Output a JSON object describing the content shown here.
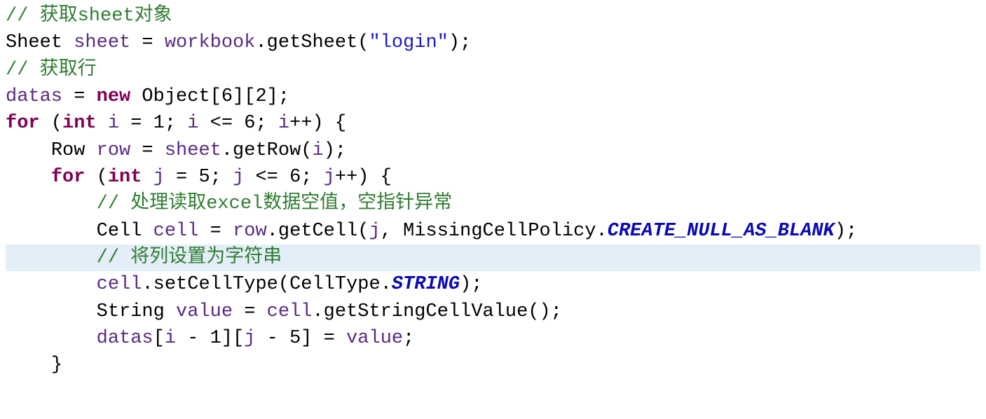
{
  "code": {
    "l0_comment": "// 获取sheet对象",
    "l1_a": "Sheet ",
    "l1_b": "sheet",
    "l1_c": " = ",
    "l1_d": "workbook",
    "l1_e": ".getSheet(",
    "l1_f": "\"login\"",
    "l1_g": ");",
    "l2_comment": "// 获取行",
    "l3_a": "datas",
    "l3_b": " = ",
    "l3_c": "new",
    "l3_d": " Object[6][2];",
    "l4_a": "for",
    "l4_b": " (",
    "l4_c": "int",
    "l4_d": " ",
    "l4_e": "i",
    "l4_f": " = 1; ",
    "l4_g": "i",
    "l4_h": " <= 6; ",
    "l4_i": "i",
    "l4_j": "++) {",
    "l5_indent": "    ",
    "l5_a": "Row ",
    "l5_b": "row",
    "l5_c": " = ",
    "l5_d": "sheet",
    "l5_e": ".getRow(",
    "l5_f": "i",
    "l5_g": ");",
    "l6_indent": "    ",
    "l6_a": "for",
    "l6_b": " (",
    "l6_c": "int",
    "l6_d": " ",
    "l6_e": "j",
    "l6_f": " = 5; ",
    "l6_g": "j",
    "l6_h": " <= 6; ",
    "l6_i": "j",
    "l6_j": "++) {",
    "l7_indent": "        ",
    "l7_comment": "// 处理读取excel数据空值，空指针异常",
    "l8_indent": "        ",
    "l8_a": "Cell ",
    "l8_b": "cell",
    "l8_c": " = ",
    "l8_d": "row",
    "l8_e": ".getCell(",
    "l8_f": "j",
    "l8_g": ", MissingCellPolicy.",
    "l8_h": "CREATE_NULL_AS_BLANK",
    "l8_i": ");",
    "l9_indent": "        ",
    "l9_comment": "// 将列设置为字符串",
    "l10_indent": "        ",
    "l10_a": "cell",
    "l10_b": ".setCellType(CellType.",
    "l10_c": "STRING",
    "l10_d": ");",
    "l11_indent": "        ",
    "l11_a": "String ",
    "l11_b": "value",
    "l11_c": " = ",
    "l11_d": "cell",
    "l11_e": ".getStringCellValue();",
    "l12_indent": "        ",
    "l12_a": "datas",
    "l12_b": "[",
    "l12_c": "i",
    "l12_d": " - 1][",
    "l12_e": "j",
    "l12_f": " - 5] = ",
    "l12_g": "value",
    "l12_h": ";",
    "l13_indent": "    ",
    "l13_a": "}"
  }
}
